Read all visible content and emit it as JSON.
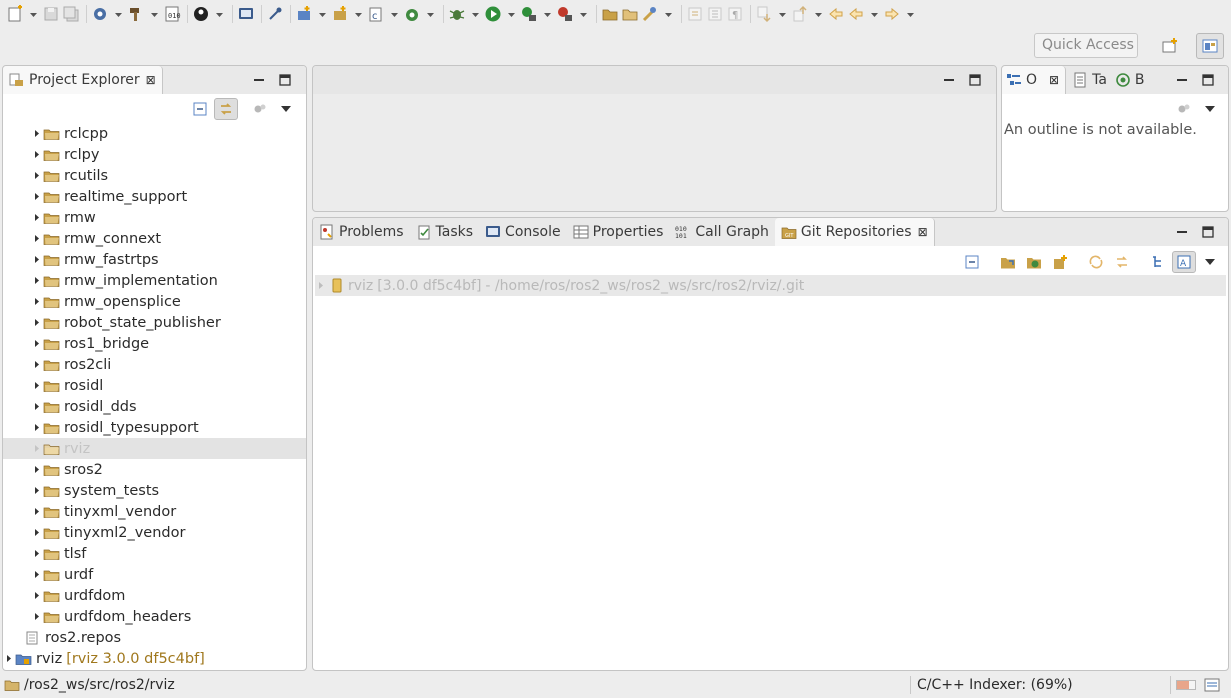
{
  "toolbar": {
    "icons": [
      "new-icon",
      "save-icon",
      "save-all-icon",
      "build-config-icon",
      "build-hammer-icon",
      "binary-icon",
      "target-icon",
      "terminal-icon",
      "debug-pin-icon",
      "new-project-icon",
      "new-package-icon",
      "new-cpp-class-icon",
      "new-source-icon",
      "debug-icon",
      "run-icon",
      "run-config-icon",
      "external-tool-icon",
      "open-folder-icon",
      "open-type-icon",
      "search-icon",
      "annotation-icon",
      "toggle-mark-icon",
      "show-whitespace-icon",
      "next-annotation-icon",
      "prev-annotation-icon",
      "last-edit-icon",
      "back-icon",
      "forward-icon"
    ]
  },
  "quick_access": {
    "placeholder": "Quick Access"
  },
  "perspectives": [
    "open-perspective-icon",
    "cpp-perspective-icon"
  ],
  "project_explorer": {
    "title": "Project Explorer",
    "close": "⊠",
    "items": [
      {
        "label": "rclcpp",
        "type": "folder"
      },
      {
        "label": "rclpy",
        "type": "folder"
      },
      {
        "label": "rcutils",
        "type": "folder"
      },
      {
        "label": "realtime_support",
        "type": "folder"
      },
      {
        "label": "rmw",
        "type": "folder"
      },
      {
        "label": "rmw_connext",
        "type": "folder"
      },
      {
        "label": "rmw_fastrtps",
        "type": "folder"
      },
      {
        "label": "rmw_implementation",
        "type": "folder"
      },
      {
        "label": "rmw_opensplice",
        "type": "folder"
      },
      {
        "label": "robot_state_publisher",
        "type": "folder"
      },
      {
        "label": "ros1_bridge",
        "type": "folder"
      },
      {
        "label": "ros2cli",
        "type": "folder"
      },
      {
        "label": "rosidl",
        "type": "folder"
      },
      {
        "label": "rosidl_dds",
        "type": "folder"
      },
      {
        "label": "rosidl_typesupport",
        "type": "folder"
      },
      {
        "label": "rviz",
        "type": "folder",
        "selected": true
      },
      {
        "label": "sros2",
        "type": "folder"
      },
      {
        "label": "system_tests",
        "type": "folder"
      },
      {
        "label": "tinyxml_vendor",
        "type": "folder"
      },
      {
        "label": "tinyxml2_vendor",
        "type": "folder"
      },
      {
        "label": "tlsf",
        "type": "folder"
      },
      {
        "label": "urdf",
        "type": "folder"
      },
      {
        "label": "urdfdom",
        "type": "folder"
      },
      {
        "label": "urdfdom_headers",
        "type": "folder"
      },
      {
        "label": "ros2.repos",
        "type": "file"
      },
      {
        "label": "rviz",
        "type": "project",
        "decoration": "[rviz 3.0.0 df5c4bf]"
      }
    ]
  },
  "outline": {
    "tabs": [
      {
        "label": "O",
        "icon": "outline-icon",
        "active": true
      },
      {
        "label": "Ta",
        "icon": "task-list-icon"
      },
      {
        "label": "B",
        "icon": "build-targets-icon"
      }
    ],
    "message": "An outline is not available."
  },
  "bottom_panel": {
    "tabs": [
      {
        "label": "Problems",
        "icon": "problems-icon"
      },
      {
        "label": "Tasks",
        "icon": "tasks-icon"
      },
      {
        "label": "Console",
        "icon": "console-icon"
      },
      {
        "label": "Properties",
        "icon": "properties-icon"
      },
      {
        "label": "Call Graph",
        "icon": "call-graph-icon"
      },
      {
        "label": "Git Repositories",
        "icon": "git-repositories-icon",
        "active": true
      }
    ],
    "repo": {
      "name": "rviz",
      "branch": "[3.0.0 df5c4bf]",
      "path": "- /home/ros/ros2_ws/ros2_ws/src/ros2/rviz/.git"
    }
  },
  "status_bar": {
    "path": "/ros2_ws/src/ros2/rviz",
    "indexer": "C/C++ Indexer: (69%)",
    "indexer_progress": 0.69
  },
  "colors": {
    "folder": "#c9a148",
    "accent_blue": "#3b6fb3",
    "decoration": "#a0781d",
    "selection": "#e3e3e3"
  }
}
